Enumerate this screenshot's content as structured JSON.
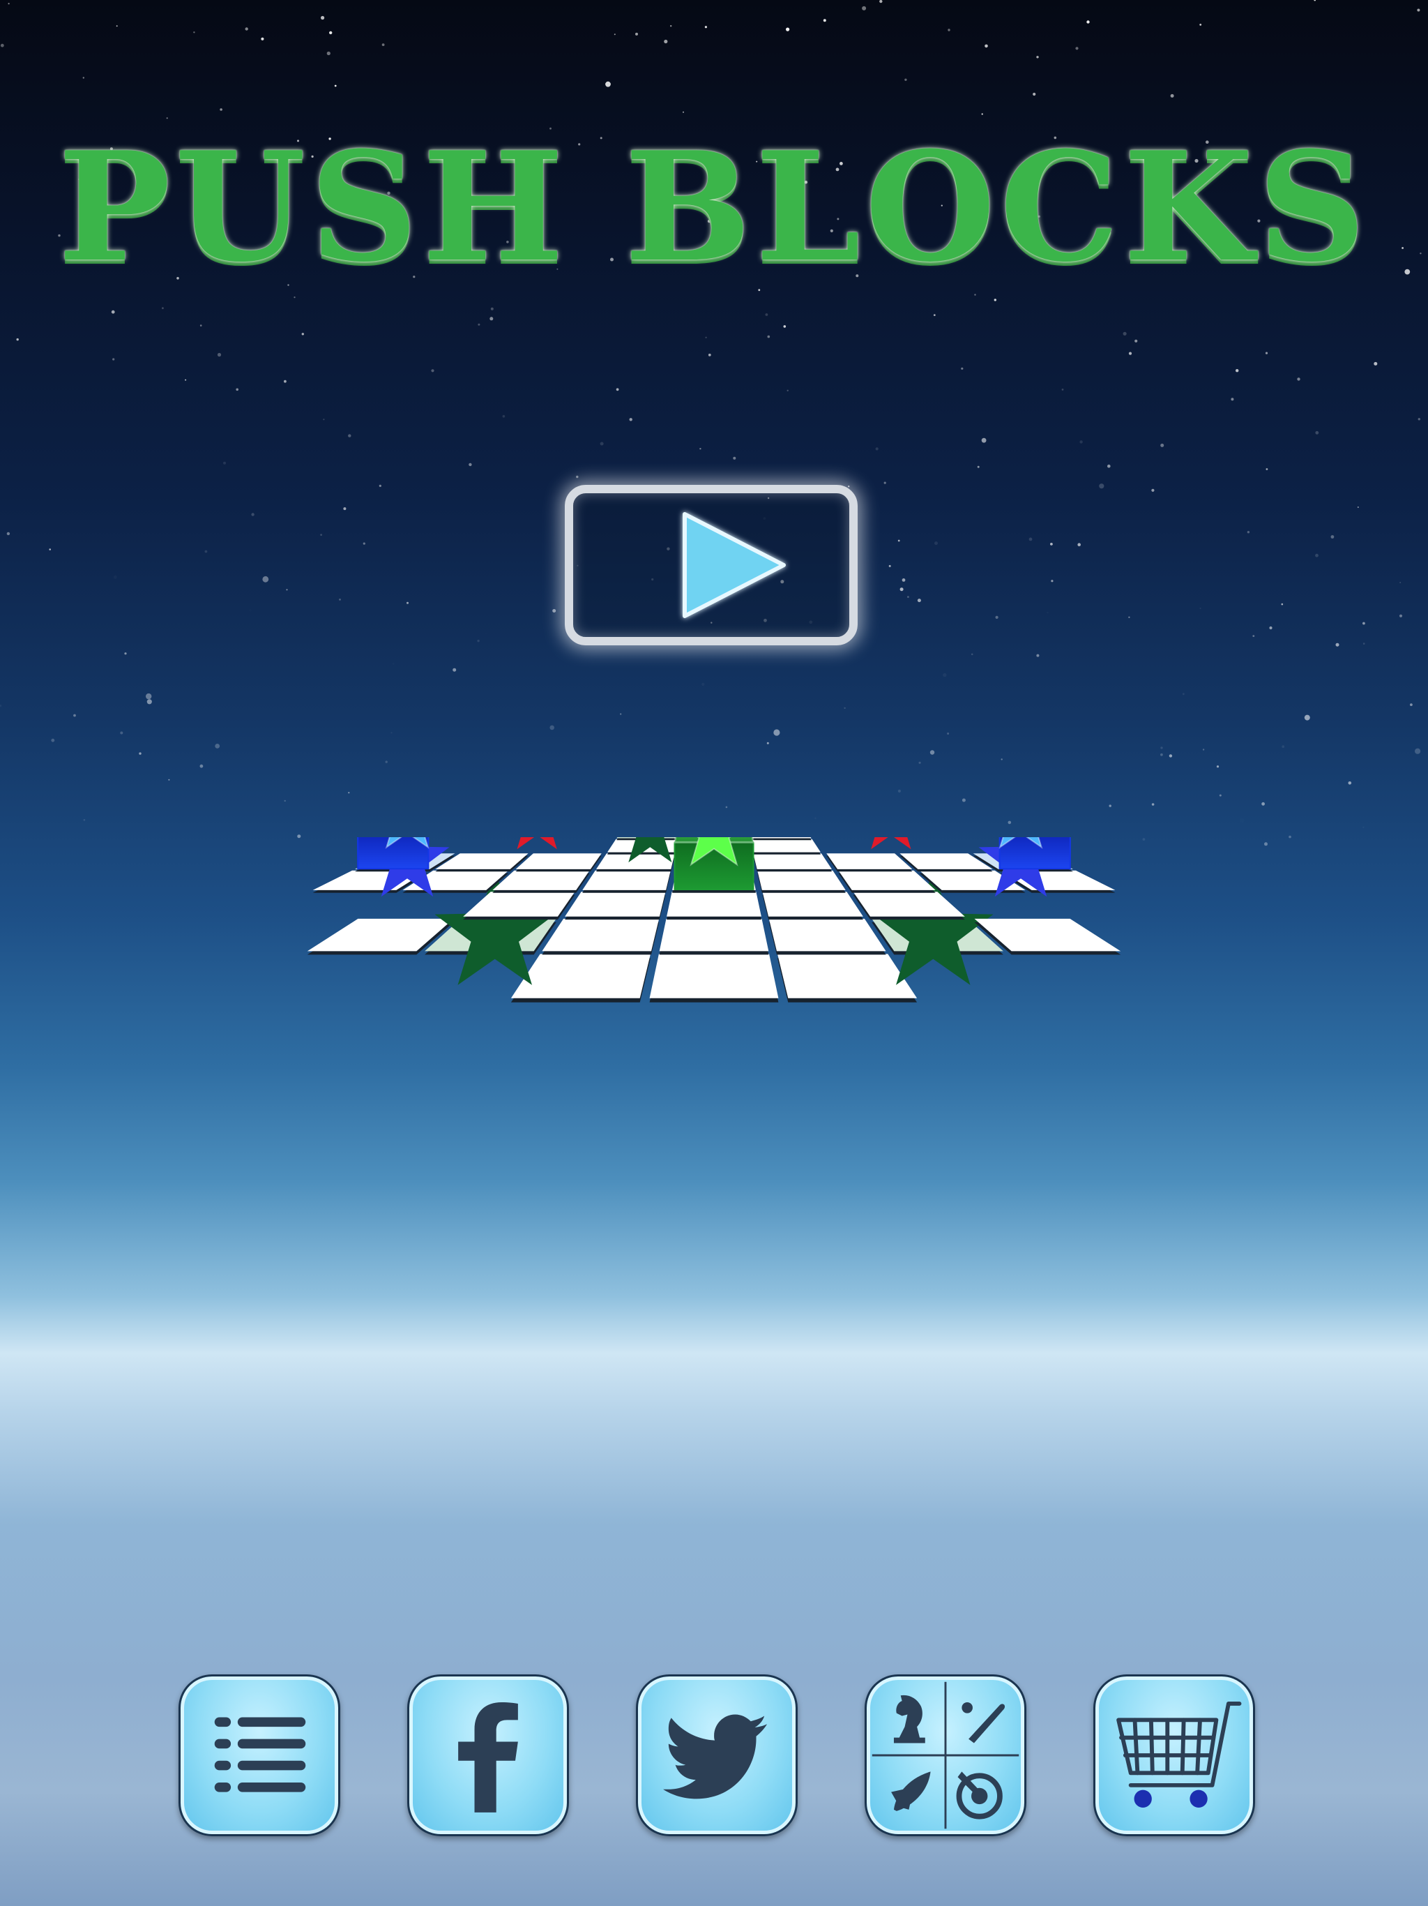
{
  "game": {
    "title": "PUSH BLOCKS"
  },
  "play_button": {
    "icon": "play-icon",
    "accent": "#6fd3f2",
    "frame": "#d6dbe2"
  },
  "board": {
    "tile_color": "#ffffff",
    "target_tile_colors": {
      "green": "#cfe6d4",
      "blue": "#cfe3f5",
      "red": "#f6cfe0"
    },
    "block_colors": {
      "green": "#1f9a34",
      "blue": "#1437e6",
      "red": "#e2401a"
    }
  },
  "bottom_bar": {
    "buttons": [
      {
        "name": "levels-menu-button",
        "icon": "list-icon",
        "label": "Levels"
      },
      {
        "name": "facebook-button",
        "icon": "facebook-icon",
        "label": "Facebook"
      },
      {
        "name": "twitter-button",
        "icon": "twitter-icon",
        "label": "Twitter"
      },
      {
        "name": "more-games-button",
        "icon": "games-grid-icon",
        "label": "More Games"
      },
      {
        "name": "shop-button",
        "icon": "shopping-cart-icon",
        "label": "Shop"
      }
    ],
    "button_color": "#8fdcf6",
    "icon_color": "#2c3f55"
  }
}
